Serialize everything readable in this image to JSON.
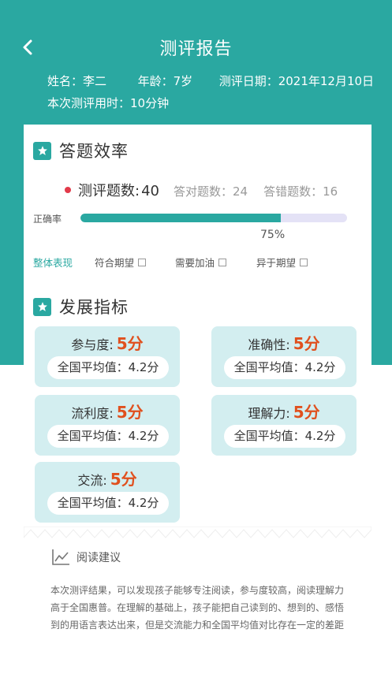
{
  "header": {
    "title": "测评报告",
    "name": "姓名：李二",
    "age": "年龄：7岁",
    "date": "测评日期：2021年12月10日",
    "duration": "本次测评用时：10分钟"
  },
  "efficiency": {
    "title": "答题效率",
    "total_label": "测评题数:",
    "total_value": "40",
    "correct": "答对题数：24",
    "wrong": "答错题数：16",
    "rate_label": "正确率",
    "rate_value": "75%",
    "rate_fraction": 0.75,
    "overall_label": "整体表现",
    "options": [
      "符合期望",
      "需要加油",
      "异于期望"
    ]
  },
  "development": {
    "title": "发展指标",
    "metrics": [
      {
        "label": "参与度:",
        "score": "5分",
        "avg": "全国平均值：4.2分"
      },
      {
        "label": "准确性:",
        "score": "5分",
        "avg": "全国平均值：4.2分"
      },
      {
        "label": "流利度:",
        "score": "5分",
        "avg": "全国平均值：4.2分"
      },
      {
        "label": "理解力:",
        "score": "5分",
        "avg": "全国平均值：4.2分"
      },
      {
        "label": "交流:",
        "score": "5分",
        "avg": "全国平均值：4.2分"
      }
    ]
  },
  "advice": {
    "title": "阅读建议",
    "text": "本次测评结果，可以发现孩子能够专注阅读，参与度较高，阅读理解力高于全国惠普。在理解的基础上，孩子能把自己读到的、想到的、感悟到的用语言表达出来，但是交流能力和全国平均值对比存在一定的差距"
  },
  "colors": {
    "primary": "#2aa8a1",
    "score": "#e0501e",
    "metric_bg": "#d3eef0",
    "dot": "#e23a4a"
  }
}
